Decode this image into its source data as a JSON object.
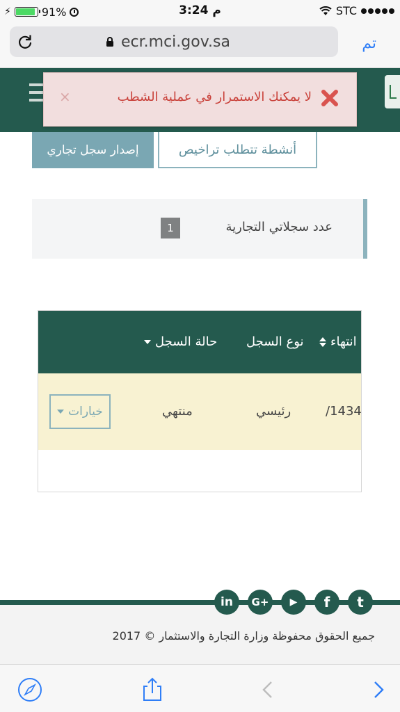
{
  "status_bar": {
    "battery_percent": "91%",
    "battery_level": 0.91,
    "time": "3:24 م",
    "carrier": "STC"
  },
  "browser": {
    "url": "ecr.mci.gov.sa",
    "done_label": "تم",
    "accent_color": "#2f7ef7"
  },
  "alert": {
    "message": "لا يمكنك الاستمرار في عملية الشطب",
    "close_symbol": "×",
    "icon": "error-x-icon",
    "text_color": "#c9413a"
  },
  "actions": {
    "issue_label": "إصدار سجل تجاري",
    "activities_label": "أنشطة تتطلب تراخيص"
  },
  "records": {
    "label": "عدد سجلاتي التجارية",
    "count": "1"
  },
  "table": {
    "headers": {
      "status": "حالة السجل",
      "type": "نوع السجل",
      "expiry": "انتهاء"
    },
    "rows": [
      {
        "expiry": "1434/",
        "type": "رئيسي",
        "status": "منتهي",
        "options_label": "خيارات"
      }
    ]
  },
  "footer": {
    "copyright": "جميع الحقوق محفوظة وزارة التجارة والاستثمار © 2017",
    "social": [
      {
        "name": "linkedin-icon",
        "glyph": "in"
      },
      {
        "name": "google-plus-icon",
        "glyph": "G+"
      },
      {
        "name": "youtube-icon",
        "glyph": "▶"
      },
      {
        "name": "facebook-icon",
        "glyph": "f"
      },
      {
        "name": "twitter-icon",
        "glyph": "t"
      }
    ]
  },
  "colors": {
    "brand": "#245a4e",
    "accent_teal": "#8cb3bd",
    "row_highlight": "#f8f2d2",
    "alert_bg": "#f2dede"
  }
}
